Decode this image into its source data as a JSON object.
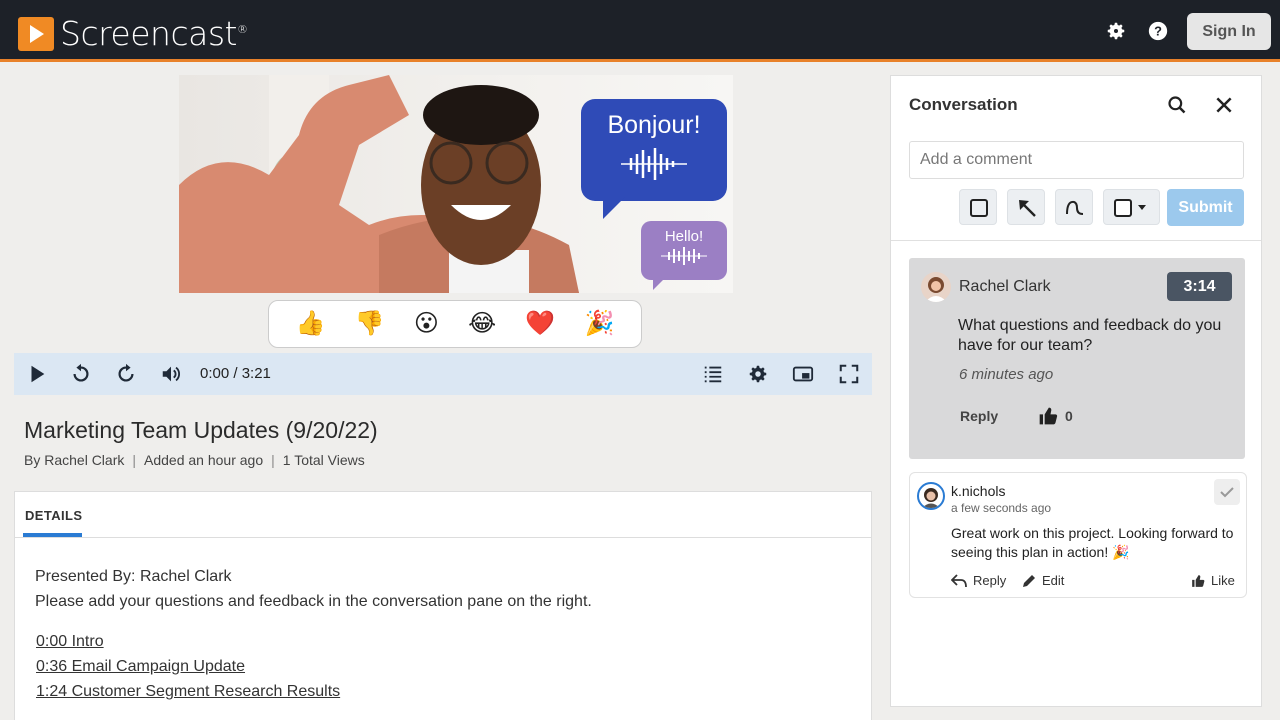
{
  "app": {
    "name": "Screencast",
    "mark": "®"
  },
  "header": {
    "signin_label": "Sign In"
  },
  "video": {
    "bubble_primary": "Bonjour!",
    "bubble_secondary": "Hello!"
  },
  "reactions": [
    "👍",
    "👎",
    "😮",
    "😂",
    "❤️",
    "🎉"
  ],
  "player": {
    "time": "0:00 / 3:21"
  },
  "recording": {
    "title": "Marketing Team Updates (9/20/22)",
    "author": "By Rachel Clark",
    "added": "Added an hour ago",
    "views": "1 Total Views"
  },
  "details": {
    "tab_label": "DETAILS",
    "presented_by": "Presented By: Rachel Clark",
    "instructions": "Please add your questions and feedback in the conversation pane on the right.",
    "chapters": [
      "0:00 Intro",
      "0:36 Email Campaign Update",
      "1:24 Customer Segment Research Results"
    ]
  },
  "conversation": {
    "title": "Conversation",
    "input_placeholder": "Add a comment",
    "submit_label": "Submit",
    "comments": [
      {
        "author": "Rachel Clark",
        "timestamp": "3:14",
        "text": "What questions and feedback do you have for our team?",
        "ago": "6 minutes ago",
        "reply_label": "Reply",
        "likes": "0"
      },
      {
        "author": "k.nichols",
        "ago": "a few seconds ago",
        "text": "Great work on this project. Looking forward to seeing this plan in action! 🎉",
        "reply_label": "Reply",
        "edit_label": "Edit",
        "like_label": "Like"
      }
    ]
  },
  "colors": {
    "accent": "#f08a24",
    "topbar": "#1d2128",
    "player_bar": "#dbe7f3",
    "submit": "#9cc9ed"
  }
}
